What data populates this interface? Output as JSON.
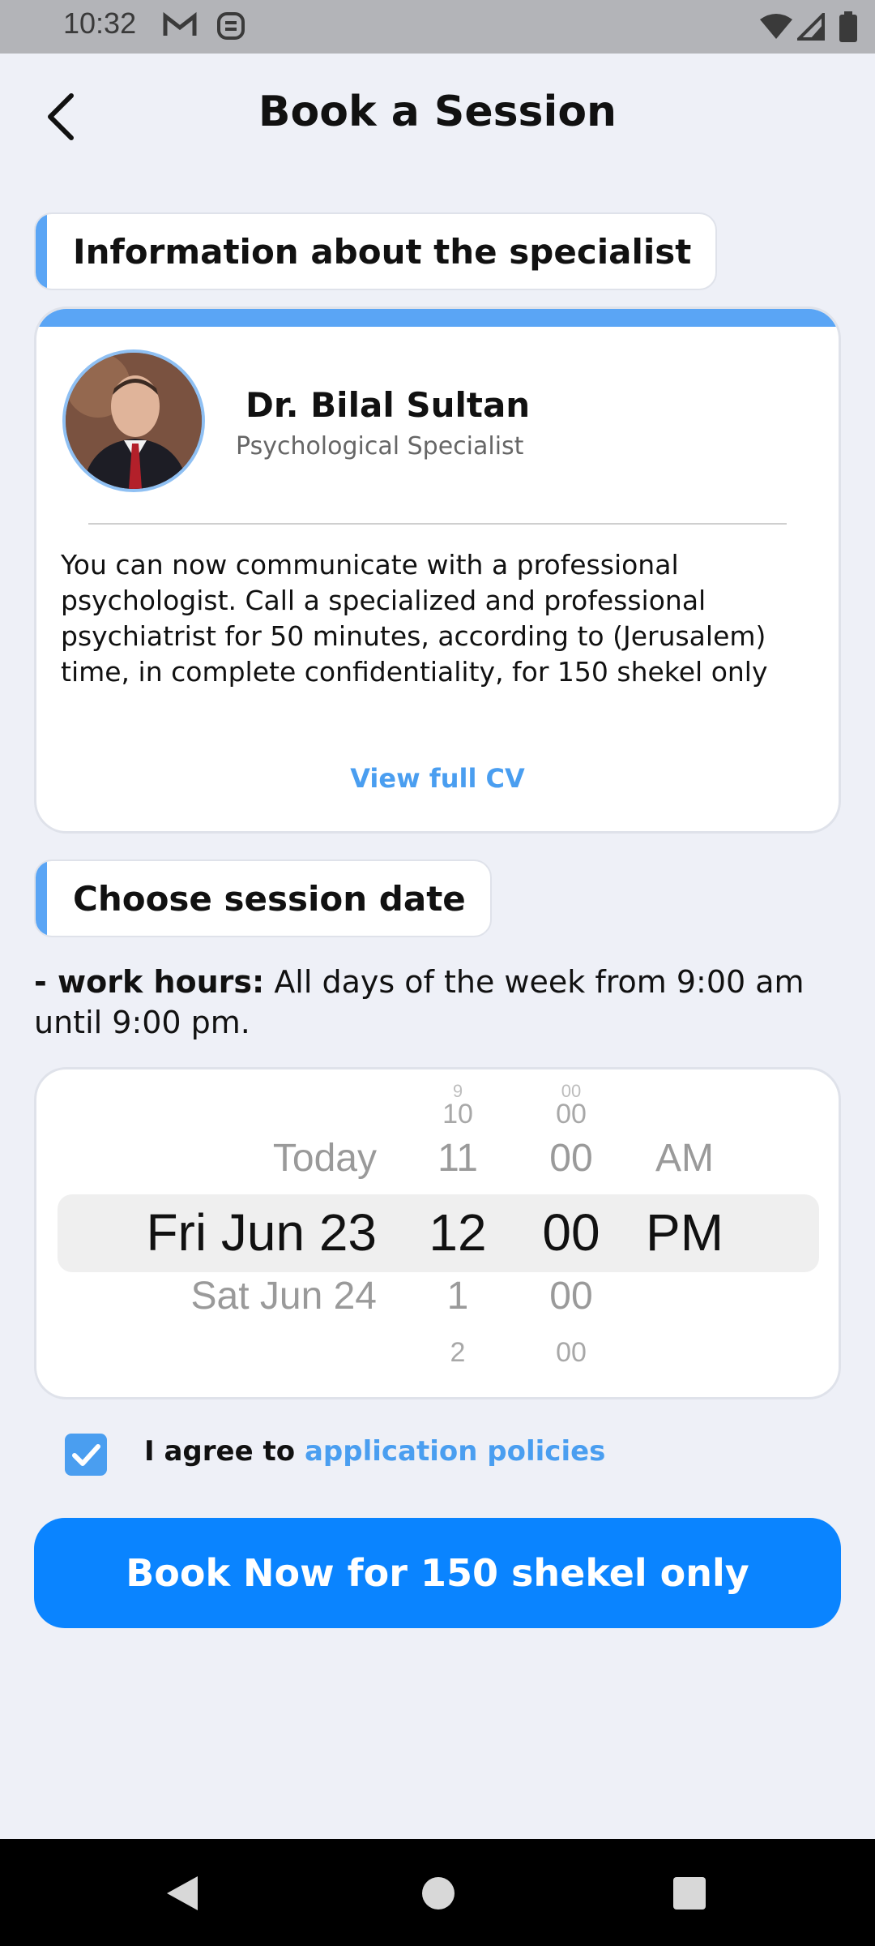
{
  "status_bar": {
    "time": "10:32"
  },
  "header": {
    "title": "Book a Session"
  },
  "specialist_section": {
    "title": "Information about the specialist"
  },
  "specialist": {
    "name": "Dr. Bilal Sultan",
    "role": "Psychological Specialist",
    "description": "You can now communicate with a professional psychologist. Call a specialized and professional psychiatrist for 50 minutes, according to (Jerusalem) time, in complete confidentiality, for 150 shekel only",
    "cv_link": "View full CV"
  },
  "date_section": {
    "title": "Choose session date",
    "hours_prefix": "- work hours:",
    "hours_text": " All days of the week from 9:00 am until 9:00 pm."
  },
  "picker": {
    "dates": {
      "prev": "Today",
      "selected": "Fri Jun 23",
      "next": "Sat Jun 24"
    },
    "hours": {
      "prev2": "10",
      "prev": "11",
      "selected": "12",
      "next": "1",
      "next2": "2"
    },
    "minutes": {
      "prev2": "00",
      "prev": "00",
      "selected": "00",
      "next": "00",
      "next2": "00"
    },
    "ampm": {
      "prev": "AM",
      "selected": "PM"
    }
  },
  "agreement": {
    "checked": true,
    "prefix": "I agree to",
    "link": "application policies"
  },
  "book_button": {
    "label": "Book Now for 150 shekel only"
  },
  "colors": {
    "accent": "#5aa5f5",
    "primary_button": "#0a84ff",
    "link": "#4a9ef0"
  }
}
